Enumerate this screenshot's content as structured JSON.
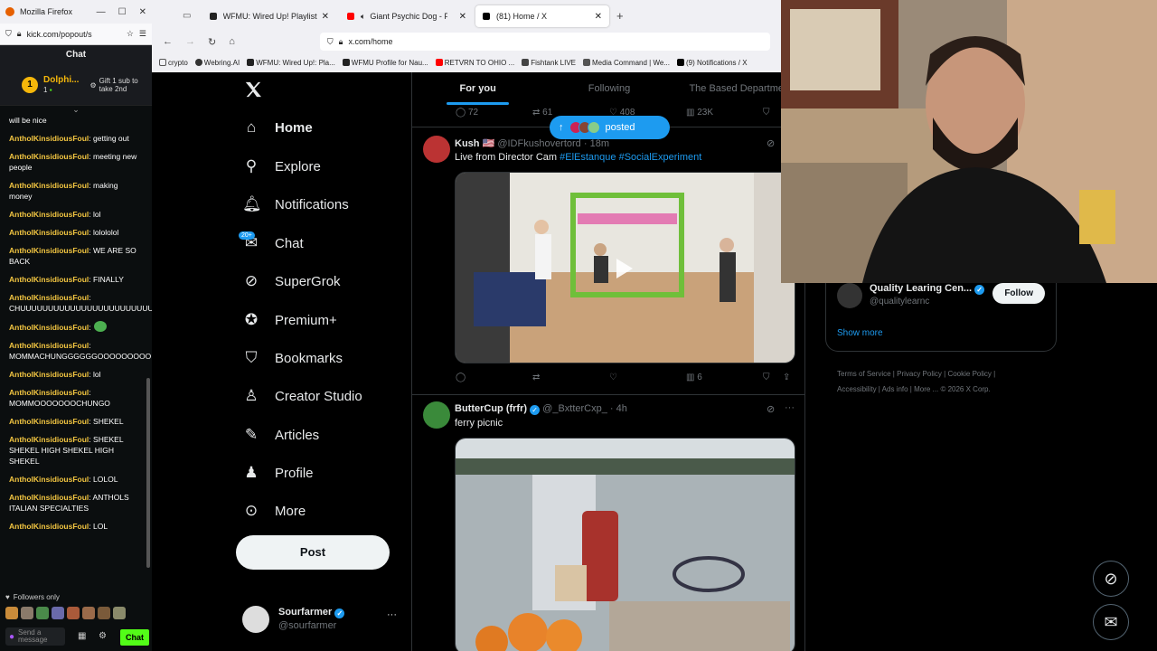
{
  "kick": {
    "window_title": "Mozilla Firefox",
    "url": "kick.com/popout/s",
    "chat_header": "Chat",
    "pinned_user": "Dolphi...",
    "pinned_count": "1",
    "pinned_coin": "1",
    "gift_text": "Gift 1 sub to take 2nd",
    "messages": [
      {
        "user": "",
        "text": "will be nice"
      },
      {
        "user": "AntholKinsidiousFoul",
        "text": ": getting out"
      },
      {
        "user": "AntholKinsidiousFoul",
        "text": ": meeting new people"
      },
      {
        "user": "AntholKinsidiousFoul",
        "text": ": making money"
      },
      {
        "user": "AntholKinsidiousFoul",
        "text": ": lol"
      },
      {
        "user": "AntholKinsidiousFoul",
        "text": ": lolololol"
      },
      {
        "user": "AntholKinsidiousFoul",
        "text": ": WE ARE SO BACK"
      },
      {
        "user": "AntholKinsidiousFoul",
        "text": ": FINALLY"
      },
      {
        "user": "AntholKinsidiousFoul",
        "text": ": CHUUUUUUUUUUUUUUUUUUUUUUUUUUUUUUUUUUUUUD"
      },
      {
        "user": "AntholKinsidiousFoul",
        "text": ":"
      },
      {
        "user": "AntholKinsidiousFoul",
        "text": ": MOMMACHUNGGGGGGOOOOOOOOO"
      },
      {
        "user": "AntholKinsidiousFoul",
        "text": ": lol"
      },
      {
        "user": "AntholKinsidiousFoul",
        "text": ": MOMMOOOOOOOCHUNGO"
      },
      {
        "user": "AntholKinsidiousFoul",
        "text": ": SHEKEL"
      },
      {
        "user": "AntholKinsidiousFoul",
        "text": ": SHEKEL SHEKEL HIGH SHEKEL HIGH SHEKEL"
      },
      {
        "user": "AntholKinsidiousFoul",
        "text": ": LOLOL"
      },
      {
        "user": "AntholKinsidiousFoul",
        "text": ": ANTHOLS ITALIAN SPECIALTIES"
      },
      {
        "user": "AntholKinsidiousFoul",
        "text": ": LOL"
      }
    ],
    "followers_only": "Followers only",
    "send_placeholder": "Send a message",
    "chat_button": "Chat"
  },
  "firefox": {
    "tabs": [
      {
        "label": "WFMU: Wired Up! Playlist from",
        "active": false
      },
      {
        "label": "Giant Psychic Dog - Perple",
        "active": false
      },
      {
        "label": "(81) Home / X",
        "active": true
      }
    ],
    "url": "x.com/home",
    "bookmarks": [
      "crypto",
      "Webring.AI",
      "WFMU: Wired Up!: Pla...",
      "WFMU Profile for Nau...",
      "RETVRN TO OHIO ...",
      "Fishtank LIVE",
      "Media Command | We...",
      "(9) Notifications / X"
    ]
  },
  "xnav": {
    "items": [
      "Home",
      "Explore",
      "Notifications",
      "Chat",
      "SuperGrok",
      "Premium+",
      "Bookmarks",
      "Creator Studio",
      "Articles",
      "Profile",
      "More"
    ],
    "chat_badge": "20+",
    "post_button": "Post",
    "account_name": "Sourfarmer",
    "account_handle": "@sourfarmer",
    "account_more": "···"
  },
  "feed": {
    "tabs": [
      "For you",
      "Following",
      "The Based Department"
    ],
    "top_actions": {
      "replies": "72",
      "reposts": "61",
      "likes": "408",
      "views": "23K"
    },
    "posted_pill": "posted",
    "tweets": [
      {
        "name": "Kush 🇺🇸",
        "handle": "@IDFkushovertord · 18m",
        "text": "Live from Director Cam",
        "tags": "#ElEstanque #SocialExperiment",
        "views": "6"
      },
      {
        "name": "ButterCup (frfr)",
        "handle": "@_BxtterCxp_ · 4h",
        "text": "ferry picnic",
        "more": "···"
      }
    ]
  },
  "right": {
    "suggest_name": "Quality Learing Cen...",
    "suggest_handle": "@qualitylearnc",
    "follow_button": "Follow",
    "show_more": "Show more",
    "footer": [
      "Terms of Service",
      "Privacy Policy",
      "Cookie Policy",
      "Accessibility",
      "Ads info",
      "More ...",
      "© 2026 X Corp."
    ]
  },
  "colors": {
    "x_blue": "#1d9bf0",
    "kick_green": "#53fc18",
    "kick_user": "#f2c541"
  }
}
